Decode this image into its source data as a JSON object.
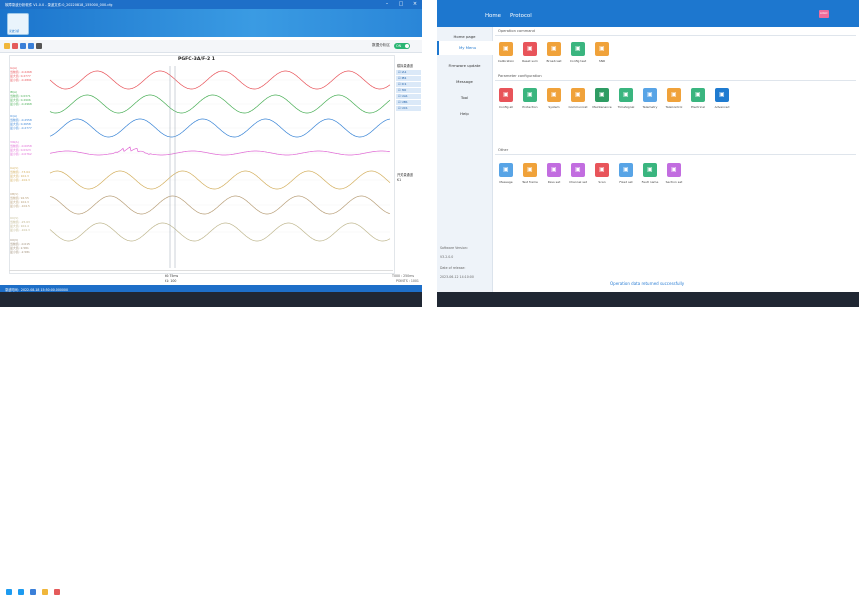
{
  "left_window": {
    "title": "故障录波分析软件  V1.0.0 - 录波文件:0_20220818_155000_000.cfg",
    "toolbar_label": "数据分析区",
    "toolbar_toggle": "ON",
    "plot_title": "PGFC-3A/F-2 1",
    "channels": [
      {
        "label1": "IA(A)",
        "label2": "当前值: -0.2268",
        "label3": "最大值: 0.2777",
        "label4": "最小值: -0.2891"
      },
      {
        "label1": "IB(A)",
        "label2": "当前值: 0.0371",
        "label3": "最大值: 0.2906",
        "label4": "最小值: -0.2968"
      },
      {
        "label1": "IC(A)",
        "label2": "当前值: -0.2558",
        "label3": "最大值: 0.2658",
        "label4": "最小值: -0.2777"
      },
      {
        "label1": "3I0(A)",
        "label2": "当前值: -0.0058",
        "label3": "最大值: 0.0323",
        "label4": "最小值: -0.0762"
      },
      {
        "label1": "UA(V)",
        "label2": "当前值: -73.64",
        "label3": "最大值: 104.3",
        "label4": "最小值: -104.3"
      },
      {
        "label1": "UB(V)",
        "label2": "当前值: 94.55",
        "label3": "最大值: 104.3",
        "label4": "最小值: -104.5"
      },
      {
        "label1": "UC(V)",
        "label2": "当前值: -25.63",
        "label3": "最大值: 104.4",
        "label4": "最小值: -104.3"
      },
      {
        "label1": "U0(V)",
        "label2": "当前值: -0.015",
        "label3": "最大值: 2.581",
        "label4": "最小值: -2.581"
      }
    ],
    "legend_title": "模拟量通道",
    "legend_items": [
      "IA1",
      "IB1",
      "IC1",
      "3I0",
      "UA1",
      "UB1",
      "UC1"
    ],
    "digital_title": "开关量通道",
    "digital_items": [
      "K1"
    ],
    "time_mid": "t0:75ms",
    "time_mid2": "t1: 100",
    "time_right": "T000 : 250ms",
    "time_right2": "POINTS : 1001",
    "status": "录波时间：2022-08-18 15:50:00.000000"
  },
  "right_window": {
    "nav": [
      "Home",
      "Protocol"
    ],
    "sidebar": [
      "Home page",
      "My Menu",
      "Firmware update",
      "Message",
      "Tool",
      "Help"
    ],
    "sidebar_footer": [
      "Software Version:",
      "V3.2.0.0",
      "Date of release:",
      "2023-06-12 14:10:00"
    ],
    "sections": [
      {
        "title": "Operation command",
        "tiles": [
          "Calibration",
          "Reset sum",
          "Broadcast",
          "Config test",
          "SNR"
        ]
      },
      {
        "title": "Parameter configuration",
        "tiles": [
          "Config all",
          "Protection",
          "System",
          "Communicat",
          "Maintenance",
          "TimeSignal",
          "Telemetry",
          "TeleControl",
          "Electrical",
          "Advanced"
        ]
      },
      {
        "title": "Other",
        "tiles": [
          "Message",
          "Test frame",
          "Rsvs set",
          "Channel set",
          "Scan",
          "Fixed set",
          "Fault name",
          "Section set"
        ]
      }
    ],
    "status": "Operation data returned successfully"
  },
  "colors": {
    "accent": "#1d77cf",
    "wave1": "#e8545a",
    "wave2": "#4aaf57",
    "wave3": "#3a85d6",
    "wave4": "#e06ad5",
    "wave5": "#d4b060",
    "wave6": "#b9a07a",
    "wave7": "#c0b890"
  }
}
